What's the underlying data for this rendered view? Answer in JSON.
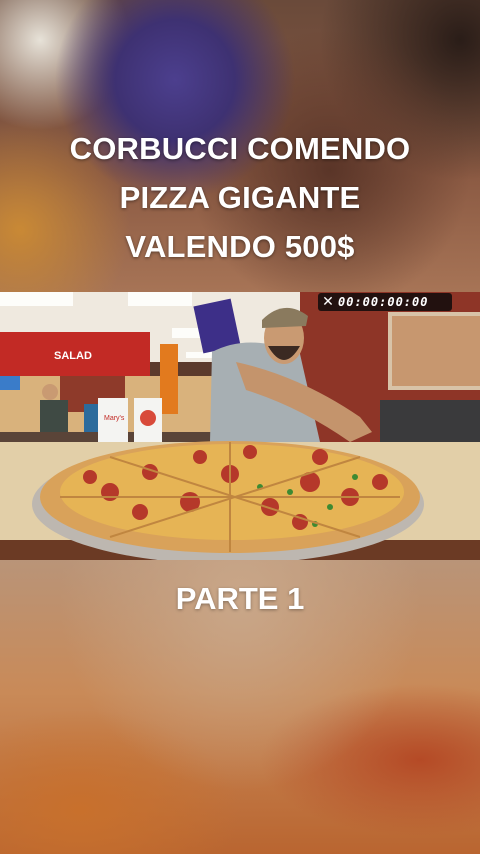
{
  "headline": {
    "line1": "CORBUCCI COMENDO",
    "line2": "PIZZA GIGANTE",
    "line3": "VALENDO 500$"
  },
  "video": {
    "timer": "00:00:00:00",
    "close_glyph": "✕",
    "scene": {
      "sign_text": "SALAD",
      "cup_text": "Mary's"
    }
  },
  "caption": {
    "part": "PARTE 1"
  },
  "colors": {
    "text": "#ffffff",
    "timer_bg": "#0a0a0a",
    "restaurant_wall": "#c22a25",
    "pizza_crust": "#d9a25a",
    "pizza_cheese": "#e6b455"
  }
}
